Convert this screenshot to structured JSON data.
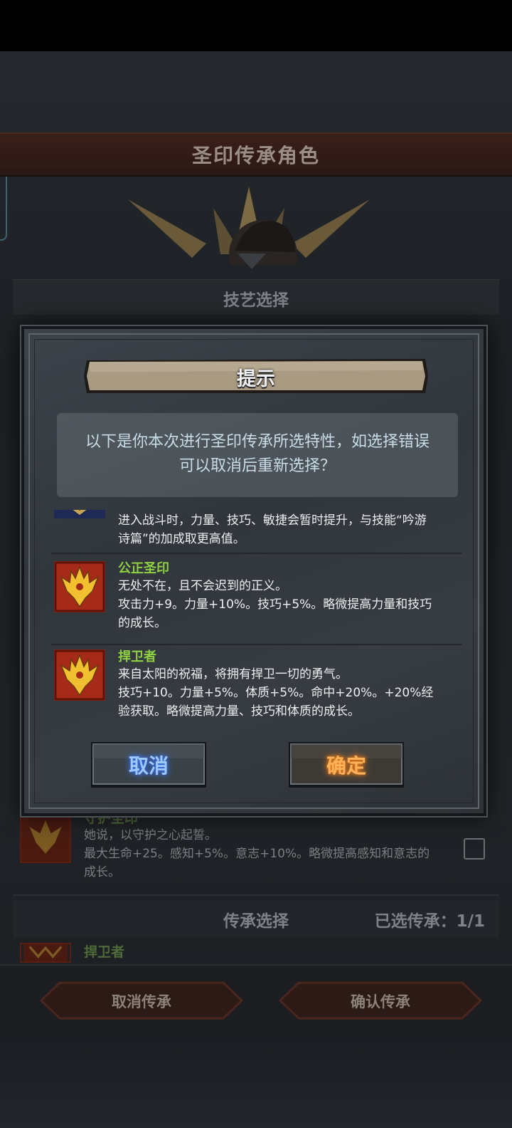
{
  "background": {
    "title": "圣印传承角色",
    "section_title": "技艺选择",
    "items": [
      {
        "name": "守护圣印",
        "desc": "她说，以守护之心起誓。",
        "desc2": "最大生命+25。感知+5%。意志+10%。略微提高感知和意志的",
        "desc3": "成长。"
      },
      {
        "name": "捍卫者"
      }
    ],
    "inherit_title": "传承选择",
    "inherit_count": "已选传承：1/1",
    "cancel_inherit_label": "取消传承",
    "confirm_inherit_label": "确认传承"
  },
  "modal": {
    "title": "提示",
    "prompt_line1": "以下是你本次进行圣印传承所选特性，如选择错误",
    "prompt_line2": "可以取消后重新选择？",
    "entries": [
      {
        "name": "",
        "desc_lines": [
          "进入战斗时，力量、技巧、敏捷会暂时提升，与技能“吟游",
          "诗篇”的加成取更高值。"
        ]
      },
      {
        "name": "公正圣印",
        "desc_lines": [
          "无处不在，且不会迟到的正义。",
          "攻击力+9。力量+10%。技巧+5%。略微提高力量和技巧",
          "的成长。"
        ]
      },
      {
        "name": "捍卫者",
        "desc_lines": [
          "来自太阳的祝福，将拥有捍卫一切的勇气。",
          "技巧+10。力量+5%。体质+5%。命中+20%。+20%经",
          "验获取。略微提高力量、技巧和体质的成长。"
        ]
      }
    ],
    "cancel_label": "取消",
    "confirm_label": "确定"
  },
  "colors": {
    "skill_name": "#8fd042",
    "cancel_glow": "#3c7bff",
    "confirm_glow": "#ff8a1e"
  }
}
